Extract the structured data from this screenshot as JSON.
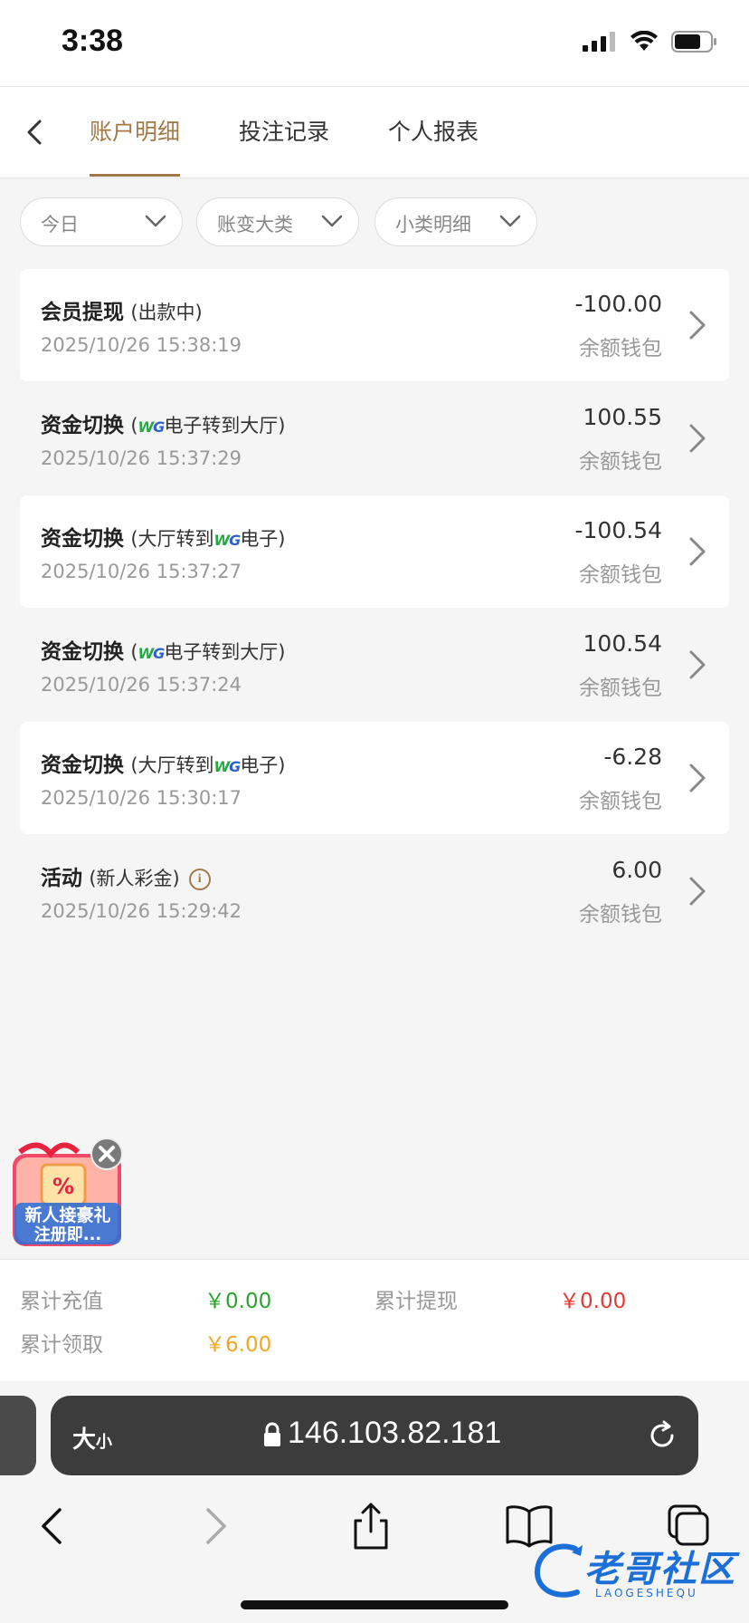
{
  "status_bar": {
    "time": "3:38"
  },
  "nav": {
    "tabs": [
      {
        "label": "账户明细",
        "active": true
      },
      {
        "label": "投注记录",
        "active": false
      },
      {
        "label": "个人报表",
        "active": false
      }
    ]
  },
  "filters": [
    {
      "label": "今日"
    },
    {
      "label": "账变大类"
    },
    {
      "label": "小类明细"
    }
  ],
  "records": [
    {
      "title": "会员提现",
      "detail_before": "(出款中)",
      "brand": "",
      "detail_after": "",
      "time": "2025/10/26 15:38:19",
      "amount": "-100.00",
      "wallet": "余额钱包",
      "info_icon": false
    },
    {
      "title": "资金切换",
      "detail_before": "(",
      "brand": "WG",
      "detail_after": "电子转到大厅)",
      "time": "2025/10/26 15:37:29",
      "amount": "100.55",
      "wallet": "余额钱包",
      "info_icon": false
    },
    {
      "title": "资金切换",
      "detail_before": "(大厅转到",
      "brand": "WG",
      "detail_after": "电子)",
      "time": "2025/10/26 15:37:27",
      "amount": "-100.54",
      "wallet": "余额钱包",
      "info_icon": false
    },
    {
      "title": "资金切换",
      "detail_before": "(",
      "brand": "WG",
      "detail_after": "电子转到大厅)",
      "time": "2025/10/26 15:37:24",
      "amount": "100.54",
      "wallet": "余额钱包",
      "info_icon": false
    },
    {
      "title": "资金切换",
      "detail_before": "(大厅转到",
      "brand": "WG",
      "detail_after": "电子)",
      "time": "2025/10/26 15:30:17",
      "amount": "-6.28",
      "wallet": "余额钱包",
      "info_icon": false
    },
    {
      "title": "活动",
      "detail_before": "(新人彩金)",
      "brand": "",
      "detail_after": "",
      "time": "2025/10/26 15:29:42",
      "amount": "6.00",
      "wallet": "余额钱包",
      "info_icon": true
    }
  ],
  "promo": {
    "line1": "新人接豪礼",
    "line2": "注册即..."
  },
  "summary": {
    "recharge_label": "累计充值",
    "recharge_value": "￥0.00",
    "withdraw_label": "累计提现",
    "withdraw_value": "￥0.00",
    "claim_label": "累计领取",
    "claim_value": "￥6.00"
  },
  "browser": {
    "aa_big": "大",
    "aa_small": "小",
    "url": "146.103.82.181"
  },
  "watermark": {
    "text": "老哥社区",
    "sub": "LAOGESHEQU"
  },
  "colors": {
    "accent": "#a27a4a",
    "green": "#2aa52a",
    "red": "#e53935",
    "orange": "#f5a623",
    "wg_green": "#27a844",
    "wg_blue": "#2c62c9"
  }
}
